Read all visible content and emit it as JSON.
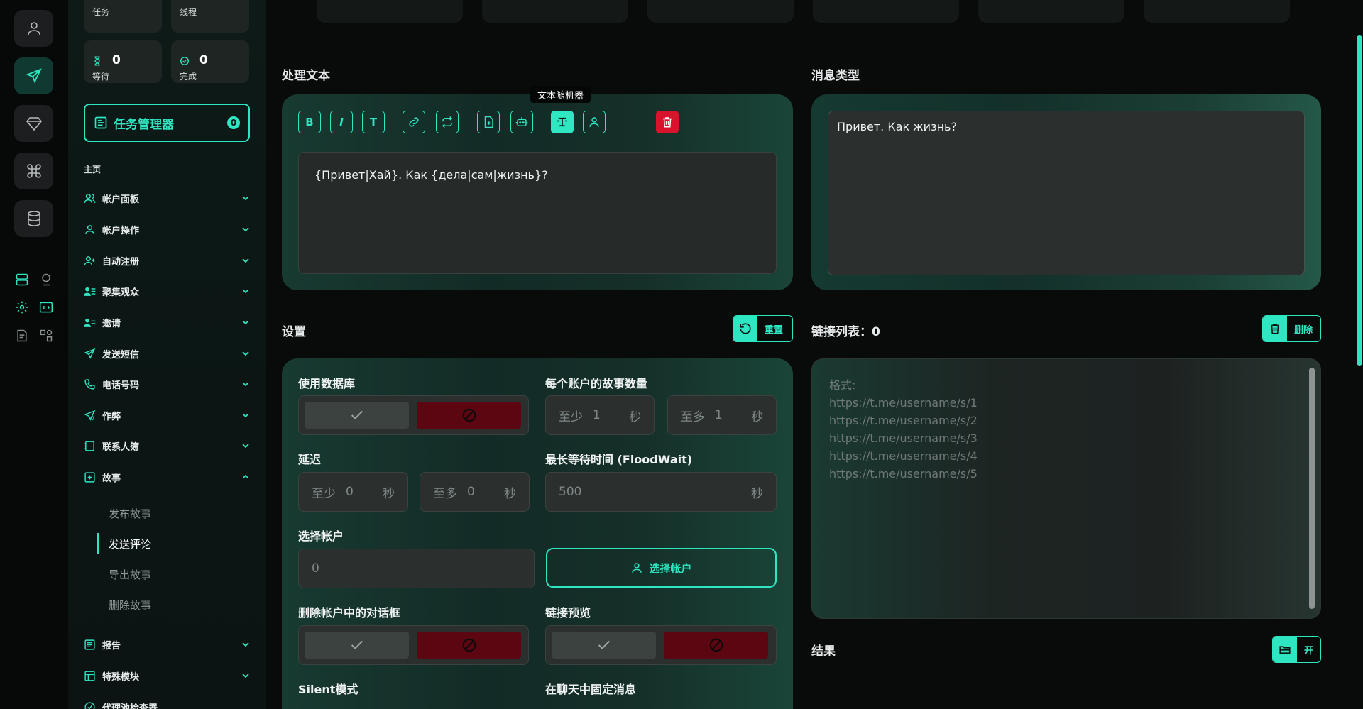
{
  "sidebar": {
    "stats": [
      {
        "label": "任务",
        "value": "0"
      },
      {
        "label": "线程",
        "value": "0"
      },
      {
        "label": "等待",
        "value": "0"
      },
      {
        "label": "完成",
        "value": "0"
      }
    ],
    "task_manager": {
      "label": "任务管理器",
      "badge": "0"
    },
    "section_title": "主页",
    "items": [
      {
        "label": "帐户面板"
      },
      {
        "label": "帐户操作"
      },
      {
        "label": "自动注册"
      },
      {
        "label": "聚集观众"
      },
      {
        "label": "邀请"
      },
      {
        "label": "发送短信"
      },
      {
        "label": "电话号码"
      },
      {
        "label": "作弊"
      },
      {
        "label": "联系人簿"
      },
      {
        "label": "故事"
      },
      {
        "label": "报告"
      },
      {
        "label": "特殊模块"
      },
      {
        "label": "代理池检查器"
      }
    ],
    "story_sub_items": [
      {
        "label": "发布故事"
      },
      {
        "label": "发送评论"
      },
      {
        "label": "导出故事"
      },
      {
        "label": "删除故事"
      }
    ]
  },
  "editor": {
    "title": "处理文本",
    "tooltip": "文本随机器",
    "text": "{Привет|Хай}. Как {дела|сам|жизнь}?"
  },
  "message_type": {
    "title": "消息类型",
    "preview": "Привет. Как жизнь?"
  },
  "settings": {
    "title": "设置",
    "reset_label": "重置",
    "use_database": "使用数据库",
    "stories_per_account": "每个账户的故事数量",
    "stories_min": {
      "prefix": "至少",
      "value": "1",
      "unit": "秒"
    },
    "stories_max": {
      "prefix": "至多",
      "value": "1",
      "unit": "秒"
    },
    "delay": "延迟",
    "delay_min": {
      "prefix": "至少",
      "value": "0",
      "unit": "秒"
    },
    "delay_max": {
      "prefix": "至多",
      "value": "0",
      "unit": "秒"
    },
    "floodwait": "最长等待时间 (FloodWait)",
    "floodwait_value": {
      "value": "500",
      "unit": "秒"
    },
    "select_account": "选择帐户",
    "select_account_value": "0",
    "select_account_button": "选择帐户",
    "delete_dialogs": "删除帐户中的对话框",
    "link_preview": "链接预览",
    "silent_mode": "Silent模式",
    "pin_message": "在聊天中固定消息"
  },
  "links": {
    "title": "链接列表：0",
    "delete_label": "删除",
    "placeholder_lines": [
      "格式:",
      "https://t.me/username/s/1",
      "https://t.me/username/s/2",
      "https://t.me/username/s/3",
      "https://t.me/username/s/4",
      "https://t.me/username/s/5"
    ]
  },
  "results": {
    "title": "结果",
    "open_label": "开"
  },
  "colors": {
    "accent": "#2fe6c2",
    "danger": "#d8132b",
    "background": "#090a0a"
  }
}
